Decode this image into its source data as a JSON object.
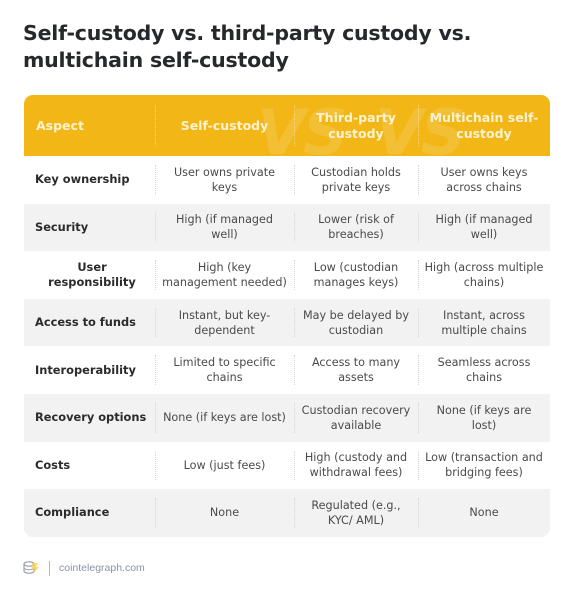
{
  "title": "Self-custody vs. third-party custody vs. multichain self-custody",
  "colors": {
    "header_bg": "#f2b616",
    "header_text": "#fdf3d2",
    "alt_row_bg": "#f2f2f2"
  },
  "table": {
    "watermark": "VS",
    "headers": [
      "Aspect",
      "Self-custody",
      "Third-party custody",
      "Multichain self-custody"
    ],
    "rows": [
      {
        "aspect": "Key ownership",
        "self": "User owns private keys",
        "third": "Custodian holds private keys",
        "multi": "User owns keys across chains"
      },
      {
        "aspect": "Security",
        "self": "High (if managed well)",
        "third": "Lower (risk of breaches)",
        "multi": "High (if managed well)"
      },
      {
        "aspect": "User responsibility",
        "self": "High (key management needed)",
        "third": "Low (custodian manages keys)",
        "multi": "High (across multiple chains)"
      },
      {
        "aspect": "Access to funds",
        "self": "Instant, but key-dependent",
        "third": "May be delayed by custodian",
        "multi": "Instant, across multiple chains"
      },
      {
        "aspect": "Interoperability",
        "self": "Limited to specific chains",
        "third": "Access to many assets",
        "multi": "Seamless across chains"
      },
      {
        "aspect": "Recovery options",
        "self": "None (if keys are lost)",
        "third": "Custodian recovery available",
        "multi": "None (if keys are lost)"
      },
      {
        "aspect": "Costs",
        "self": "Low (just fees)",
        "third": "High (custody and withdrawal fees)",
        "multi": "Low (transaction and bridging fees)"
      },
      {
        "aspect": "Compliance",
        "self": "None",
        "third": "Regulated (e.g., KYC/ AML)",
        "multi": "None"
      }
    ]
  },
  "footer": {
    "logo_icon": "cointelegraph-logo-icon",
    "site": "cointelegraph.com"
  }
}
